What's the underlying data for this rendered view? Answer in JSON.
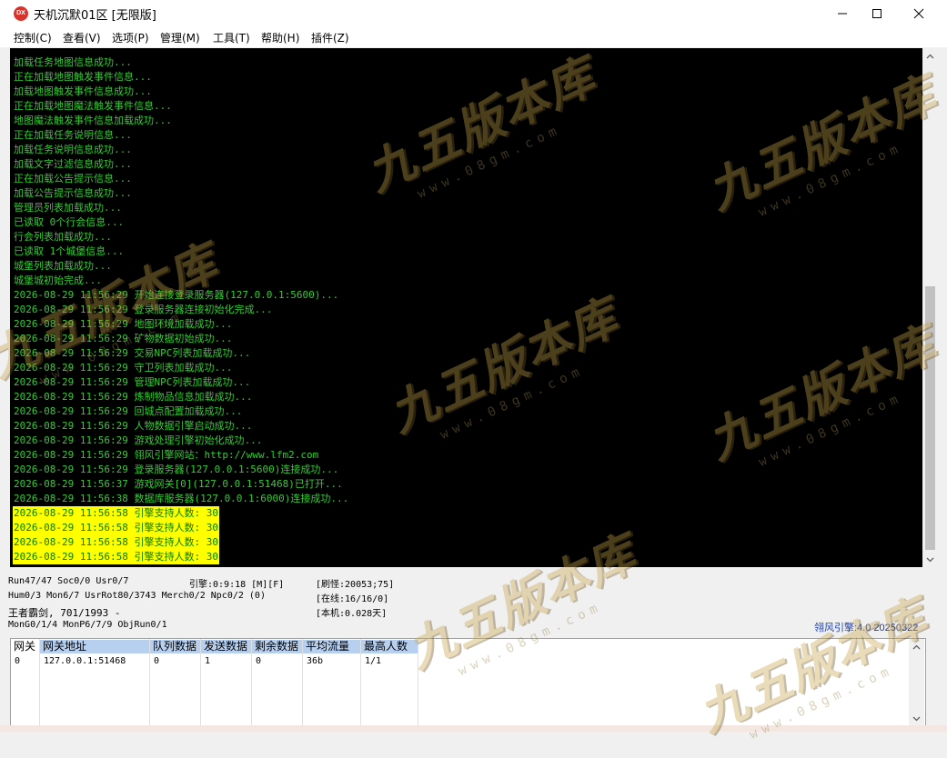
{
  "window": {
    "title": "天机沉默01区 [无限版]",
    "icon_label": "DX"
  },
  "menu": [
    {
      "label": "控制(C)"
    },
    {
      "label": "查看(V)"
    },
    {
      "label": "选项(P)"
    },
    {
      "label": "管理(M)"
    },
    {
      "label": "工具(T)"
    },
    {
      "label": "帮助(H)"
    },
    {
      "label": "插件(Z)"
    }
  ],
  "console": {
    "lines": [
      {
        "text": "加载任务地图信息成功...",
        "highlight": false
      },
      {
        "text": "正在加载地图触发事件信息...",
        "highlight": false
      },
      {
        "text": "加载地图触发事件信息成功...",
        "highlight": false
      },
      {
        "text": "正在加载地图魔法触发事件信息...",
        "highlight": false
      },
      {
        "text": "地图魔法触发事件信息加载成功...",
        "highlight": false
      },
      {
        "text": "正在加载任务说明信息...",
        "highlight": false
      },
      {
        "text": "加载任务说明信息成功...",
        "highlight": false
      },
      {
        "text": "加载文字过滤信息成功...",
        "highlight": false
      },
      {
        "text": "正在加载公告提示信息...",
        "highlight": false
      },
      {
        "text": "加载公告提示信息成功...",
        "highlight": false
      },
      {
        "text": "管理员列表加载成功...",
        "highlight": false
      },
      {
        "text": "已读取 0个行会信息...",
        "highlight": false
      },
      {
        "text": "行会列表加载成功...",
        "highlight": false
      },
      {
        "text": "已读取 1个城堡信息...",
        "highlight": false
      },
      {
        "text": "城堡列表加载成功...",
        "highlight": false
      },
      {
        "text": "城堡城初始完成...",
        "highlight": false
      },
      {
        "text": "2026-08-29 11:56:29 开始连接登录服务器(127.0.0.1:5600)...",
        "highlight": false
      },
      {
        "text": "2026-08-29 11:56:29 登录服务器连接初始化完成...",
        "highlight": false
      },
      {
        "text": "2026-08-29 11:56:29 地图环境加载成功...",
        "highlight": false
      },
      {
        "text": "2026-08-29 11:56:29 矿物数据初始成功...",
        "highlight": false
      },
      {
        "text": "2026-08-29 11:56:29 交易NPC列表加载成功...",
        "highlight": false
      },
      {
        "text": "2026-08-29 11:56:29 守卫列表加载成功...",
        "highlight": false
      },
      {
        "text": "2026-08-29 11:56:29 管理NPC列表加载成功...",
        "highlight": false
      },
      {
        "text": "2026-08-29 11:56:29 炼制物品信息加载成功...",
        "highlight": false
      },
      {
        "text": "2026-08-29 11:56:29 回城点配置加载成功...",
        "highlight": false
      },
      {
        "text": "2026-08-29 11:56:29 人物数据引擎启动成功...",
        "highlight": false
      },
      {
        "text": "2026-08-29 11:56:29 游戏处理引擎初始化成功...",
        "highlight": false
      },
      {
        "text": "2026-08-29 11:56:29 翎风引擎网站：http://www.lfm2.com",
        "highlight": false
      },
      {
        "text": "2026-08-29 11:56:29 登录服务器(127.0.0.1:5600)连接成功...",
        "highlight": false
      },
      {
        "text": "2026-08-29 11:56:37 游戏网关[0](127.0.0.1:51468)已打开...",
        "highlight": false
      },
      {
        "text": "2026-08-29 11:56:38 数据库服务器(127.0.0.1:6000)连接成功...",
        "highlight": false
      },
      {
        "text": "2026-08-29 11:56:58 引擎支持人数: 30",
        "highlight": true
      },
      {
        "text": "2026-08-29 11:56:58 引擎支持人数: 30",
        "highlight": true
      },
      {
        "text": "2026-08-29 11:56:58 引擎支持人数: 30",
        "highlight": true
      },
      {
        "text": "2026-08-29 11:56:58 引擎支持人数: 30",
        "highlight": true
      }
    ],
    "scroll_position": 1.0
  },
  "status": {
    "run": "Run47/47 Soc0/0 Usr0/7",
    "engine_time": "引擎:0:9:18 [M][F]",
    "refresh_monster": "[刷怪:20053;75]",
    "hum": "Hum0/3 Mon6/7 UsrRot80/3743 Merch0/2 Npc0/2 (0)",
    "online": "[在线:16/16/0]",
    "player": "王者霸剑, 701/1993 -",
    "local": "[本机:0.028天]",
    "mon": "MonG0/1/4 MonP6/7/9 ObjRun0/1",
    "version": "翎风引擎:4.0 20250322"
  },
  "gateway_table": {
    "columns": [
      "网关",
      "网关地址",
      "队列数据",
      "发送数据",
      "剩余数据",
      "平均流量",
      "最高人数"
    ],
    "rows": [
      [
        "0",
        "127.0.0.1:51468",
        "0",
        "1",
        "0",
        "36b",
        "1/1"
      ]
    ]
  },
  "watermark": {
    "brand": "九五版本库",
    "site": "www.08gm.com"
  }
}
